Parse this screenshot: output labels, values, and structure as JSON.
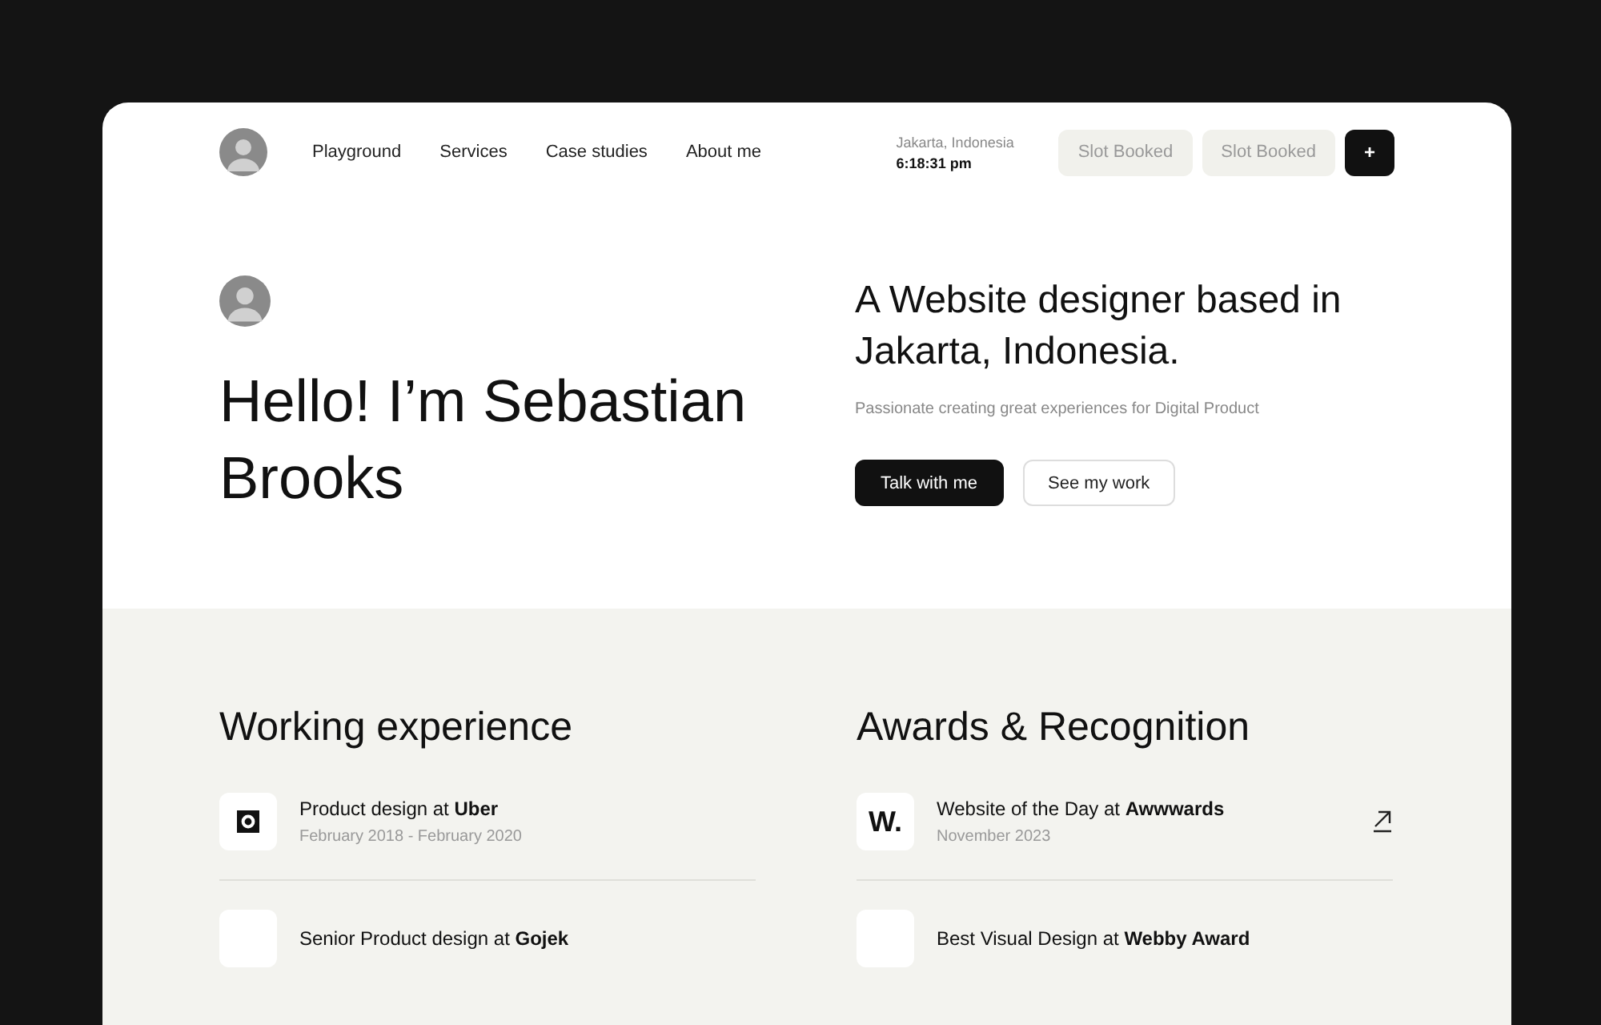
{
  "nav": {
    "links": [
      {
        "label": "Playground"
      },
      {
        "label": "Services"
      },
      {
        "label": "Case studies"
      },
      {
        "label": "About me"
      }
    ],
    "location": "Jakarta, Indonesia",
    "time": "6:18:31 pm",
    "slots": [
      {
        "label": "Slot Booked",
        "disabled": true
      },
      {
        "label": "Slot Booked",
        "disabled": true
      }
    ],
    "add_button": "+"
  },
  "hero": {
    "greeting": "Hello! I’m Sebastian Brooks",
    "headline": "A Website designer based in Jakarta, Indonesia.",
    "subtitle": "Passionate creating great experiences for Digital Product",
    "buttons": [
      {
        "label": "Talk with me",
        "kind": "primary"
      },
      {
        "label": "See my work",
        "kind": "secondary"
      }
    ]
  },
  "sections": [
    {
      "title": "Working experience",
      "items": [
        {
          "title": "Product design at **Uber**",
          "date": "February 2018 - February 2020",
          "kind": "mark",
          "link": false
        },
        {
          "title": "Senior Product design at **Gojek**",
          "kind": "blank",
          "link": false
        }
      ]
    },
    {
      "title": "Awards & Recognition",
      "items": [
        {
          "title": "Website of the Day at **Awwwards**",
          "date": "November 2023",
          "kind": "letter",
          "logo_text": "W.",
          "link": true
        },
        {
          "title": "Best Visual Design at **Webby Award**",
          "kind": "blank",
          "link": false
        }
      ]
    }
  ]
}
